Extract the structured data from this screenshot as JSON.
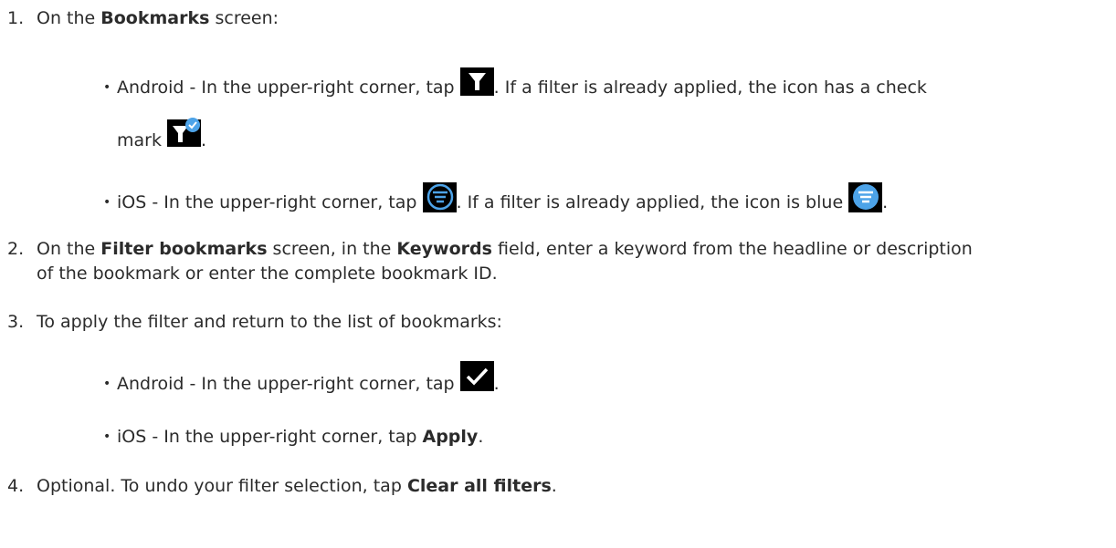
{
  "steps": [
    {
      "number": "1.",
      "parts": [
        "On the ",
        "Bookmarks",
        " screen:"
      ],
      "bullets": [
        {
          "dot": "•",
          "before_icon": "Android - In the upper-right corner, tap ",
          "icon": "filter-icon",
          "after_icon": ". If a filter is already applied, the icon has a check",
          "wrap_text": "mark ",
          "wrap_icon": "filter-check-icon",
          "wrap_after": "."
        },
        {
          "dot": "•",
          "before_icon": "iOS - In the upper-right corner, tap ",
          "icon": "filter-circle-icon",
          "after_icon": ". If a filter is already applied, the icon is blue ",
          "icon2": "filter-circle-blue-icon",
          "after_icon2": "."
        }
      ]
    },
    {
      "number": "2.",
      "parts": [
        "On the ",
        "Filter bookmarks",
        " screen, in the ",
        "Keywords",
        " field, enter a keyword from the headline or description"
      ],
      "continuation": "of the bookmark or enter the complete bookmark ID."
    },
    {
      "number": "3.",
      "text": "To apply the filter and return to the list of bookmarks:",
      "bullets": [
        {
          "dot": "•",
          "before_icon": "Android - In the upper-right corner, tap ",
          "icon": "checkmark-icon",
          "after_icon": "."
        },
        {
          "dot": "•",
          "before_bold": "iOS - In the upper-right corner, tap ",
          "bold": "Apply",
          "after_bold": "."
        }
      ]
    },
    {
      "number": "4.",
      "before_bold": "Optional. To undo your filter selection, tap ",
      "bold": "Clear all filters",
      "after_bold": "."
    }
  ],
  "colors": {
    "text": "#2b2b2b",
    "icon_bg": "#000000",
    "blue": "#4da3e8"
  }
}
